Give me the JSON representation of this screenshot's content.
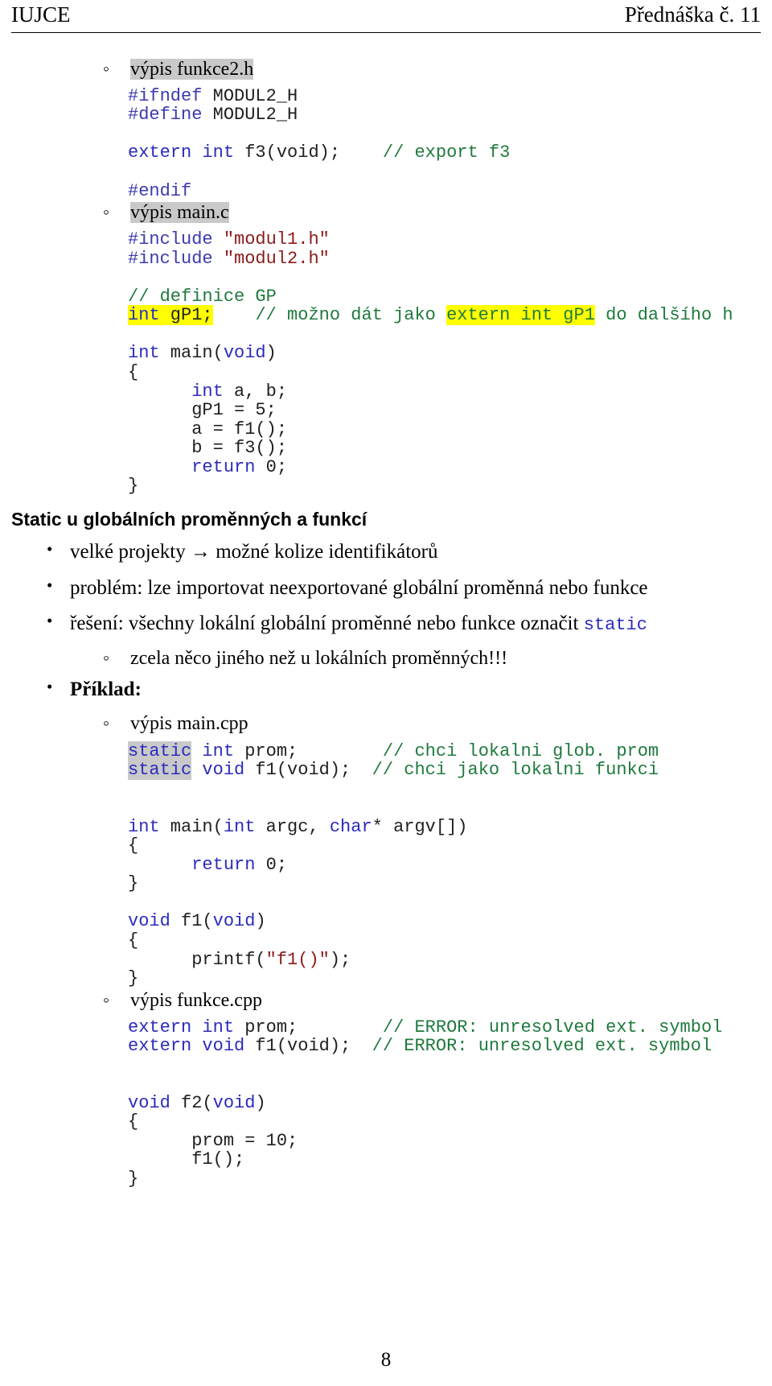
{
  "header": {
    "left_title": "IUJCE",
    "right_title": "Přednáška č. 11"
  },
  "footer": {
    "page_number": "8"
  },
  "items": {
    "funkce2_h_label": "výpis funkce2.h",
    "main_c_label": "výpis main.c",
    "main_cpp_label": "výpis main.cpp",
    "funkce_cpp_label": "výpis funkce.cpp"
  },
  "code": {
    "funkce2_h": {
      "l1_pp": "#ifndef",
      "l1_id": " MODUL2_H",
      "l2_pp": "#define",
      "l2_id": " MODUL2_H",
      "l3_kw": "extern int",
      "l3_id": " f3(void);",
      "l3_gap": "    ",
      "l3_cmt": "// export f3",
      "l4_pp": "#endif"
    },
    "main_c": {
      "inc1_pp": "#include",
      "inc1_str": " \"modul1.h\"",
      "inc2_pp": "#include",
      "inc2_str": " \"modul2.h\"",
      "cmt_def": "// definice GP",
      "gp_kw": "int",
      "gp_id": " gP1;",
      "gp_gap": "    ",
      "gp_cmt_a": "// možno dát jako ",
      "gp_cmt_hl": "extern int gP1",
      "gp_cmt_b": " do dalšího h",
      "main_kw": "int",
      "main_id": " main(",
      "main_kw2": "void",
      "main_id2": ")",
      "brace_open": "{",
      "decl_kw": "int",
      "decl_id": " a, b;",
      "assign_gp": "gP1 = 5;",
      "assign_a": "a = f1();",
      "assign_b": "b = f3();",
      "ret_kw": "return",
      "ret_val": " 0;",
      "brace_close": "}"
    },
    "main_cpp": {
      "s1_static": "static",
      "s1_kw": " int",
      "s1_id": " prom;",
      "s1_gap": "        ",
      "s1_cmt": "// chci lokalni glob. prom",
      "s2_static": "static",
      "s2_kw": " void",
      "s2_id": " f1(void);",
      "s2_gap": "  ",
      "s2_cmt": "// chci jako lokalni funkci",
      "m_kw": "int",
      "m_id": " main(",
      "m_kw2": "int",
      "m_id2": " argc, ",
      "m_kw3": "char",
      "m_id3": "* argv[])",
      "brace_open": "{",
      "ret_kw": "return",
      "ret_val": " 0;",
      "brace_close": "}",
      "f1_kw": "void",
      "f1_id": " f1(",
      "f1_kw2": "void",
      "f1_id2": ")",
      "f1_brace_open": "{",
      "f1_call": "printf(",
      "f1_str": "\"f1()\"",
      "f1_call_end": ");",
      "f1_brace_close": "}"
    },
    "funkce_cpp": {
      "e1_kw": "extern int",
      "e1_id": " prom;",
      "e1_gap": "        ",
      "e1_cmt": "// ERROR: unresolved ext. symbol",
      "e2_kw": "extern void",
      "e2_id": " f1(void);",
      "e2_gap": "  ",
      "e2_cmt": "// ERROR: unresolved ext. symbol",
      "f2_kw": "void",
      "f2_id": " f2(",
      "f2_kw2": "void",
      "f2_id2": ")",
      "brace_open": "{",
      "stmt1": "prom = 10;",
      "stmt2": "f1();",
      "brace_close": "}"
    }
  },
  "section": {
    "heading": "Static u globálních proměnných a funkcí",
    "b1": "velké projekty → možné kolize identifikátorů",
    "b2": "problém: lze importovat neexportované globální proměnná nebo funkce",
    "b3_text": "řešení: všechny lokální globální proměnné nebo funkce označit ",
    "b3_code": "static",
    "b3_sub": "zcela něco jiného než u lokálních proměnných!!!",
    "b4": "Příklad:"
  },
  "colors": {
    "keyword": "#2b2bbd",
    "preprocessor": "#3a3ab0",
    "comment": "#1f7a3d",
    "string": "#8b1a1a",
    "highlight_gray": "#c9c9c9",
    "highlight_yellow": "#ffff00"
  }
}
